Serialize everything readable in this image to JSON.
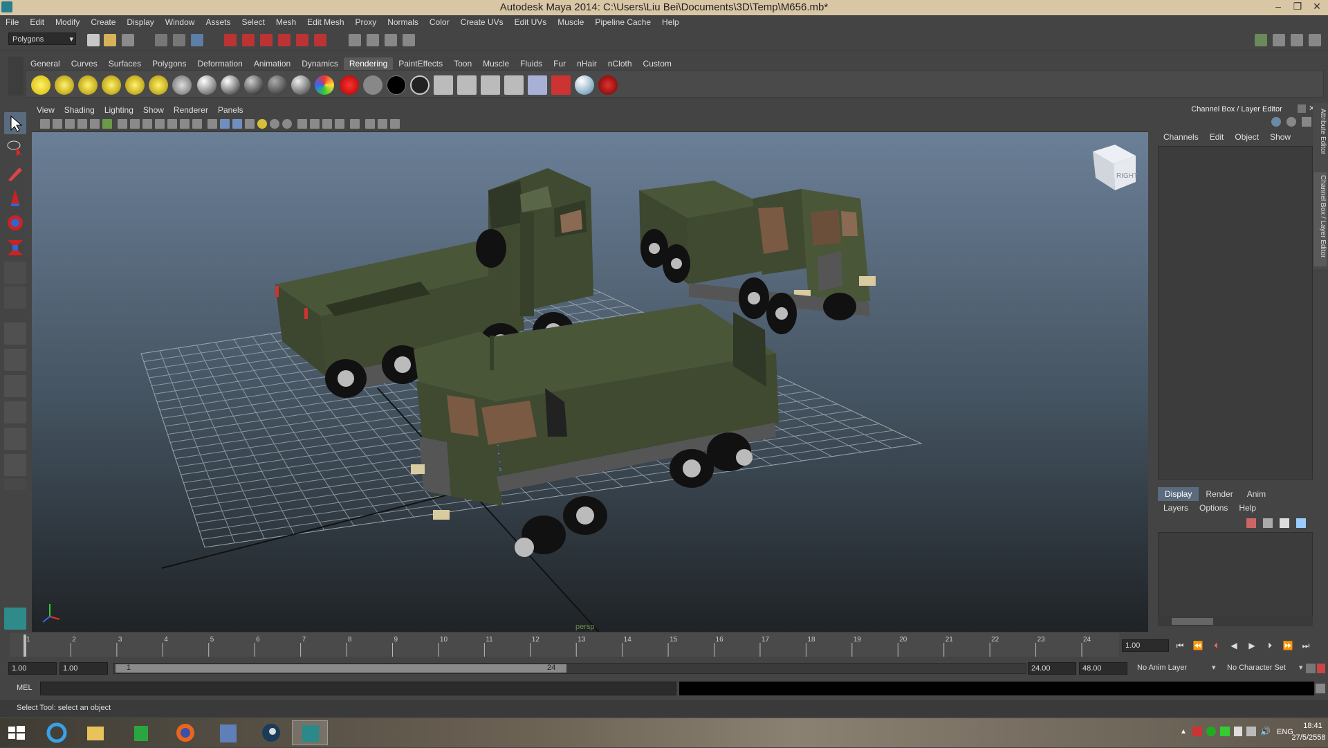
{
  "window": {
    "title": "Autodesk Maya 2014: C:\\Users\\Liu Bei\\Documents\\3D\\Temp\\M656.mb*"
  },
  "menubar": [
    "File",
    "Edit",
    "Modify",
    "Create",
    "Display",
    "Window",
    "Assets",
    "Select",
    "Mesh",
    "Edit Mesh",
    "Proxy",
    "Normals",
    "Color",
    "Create UVs",
    "Edit UVs",
    "Muscle",
    "Pipeline Cache",
    "Help"
  ],
  "statusline": {
    "mode_value": "Polygons"
  },
  "shelf": {
    "tabs": [
      "General",
      "Curves",
      "Surfaces",
      "Polygons",
      "Deformation",
      "Animation",
      "Dynamics",
      "Rendering",
      "PaintEffects",
      "Toon",
      "Muscle",
      "Fluids",
      "Fur",
      "nHair",
      "nCloth",
      "Custom"
    ],
    "active_tab": "Rendering"
  },
  "panel": {
    "menus": [
      "View",
      "Shading",
      "Lighting",
      "Show",
      "Renderer",
      "Panels"
    ],
    "camera_label": "persp",
    "viewcube_label": "RIGHT"
  },
  "channel_box": {
    "header": "Channel Box / Layer Editor",
    "menus": [
      "Channels",
      "Edit",
      "Object",
      "Show"
    ]
  },
  "layer_editor": {
    "tabs": [
      "Display",
      "Render",
      "Anim"
    ],
    "active_tab": "Display",
    "menus": [
      "Layers",
      "Options",
      "Help"
    ]
  },
  "side_tabs": [
    "Attribute Editor",
    "Channel Box / Layer Editor"
  ],
  "timeline": {
    "ticks": [
      "1",
      "2",
      "3",
      "4",
      "5",
      "6",
      "7",
      "8",
      "9",
      "10",
      "11",
      "12",
      "13",
      "14",
      "15",
      "16",
      "17",
      "18",
      "19",
      "20",
      "21",
      "22",
      "23",
      "24"
    ],
    "current_time": "1.00"
  },
  "range": {
    "start_time": "1.00",
    "playback_start": "1.00",
    "slider_start": "1",
    "slider_end": "24",
    "playback_end": "24.00",
    "end_time": "48.00",
    "anim_layer": "No Anim Layer",
    "character_set": "No Character Set"
  },
  "command": {
    "label": "MEL"
  },
  "help_line": "Select Tool: select an object",
  "taskbar": {
    "lang": "ENG",
    "time": "18:41",
    "date": "27/5/2558"
  },
  "colors": {
    "title_bg": "#d9c6a5",
    "ui_bg": "#444444",
    "active_tab": "#5a6b7e",
    "truck_green": "#3f4a30"
  }
}
